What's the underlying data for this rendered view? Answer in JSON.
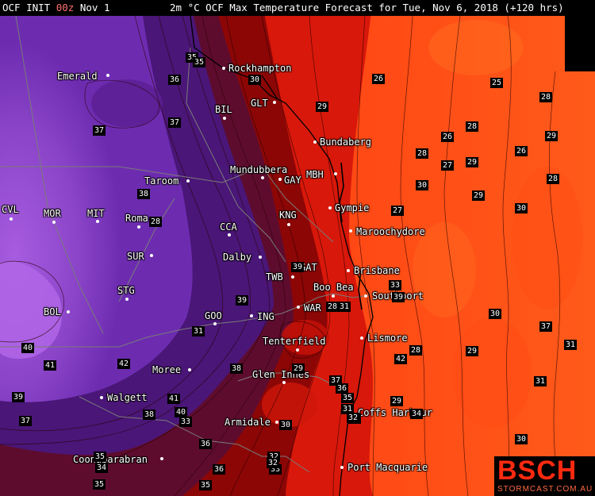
{
  "header": {
    "init_prefix": "OCF INIT ",
    "init_time": "00z",
    "init_date": " Nov 1",
    "title": "2m °C OCF Max Temperature Forecast for Tue, Nov 6, 2018 (+120 hrs)"
  },
  "places": [
    {
      "name": "Rockhampton",
      "dot": "left"
    },
    {
      "name": "Emerald",
      "dot": "right"
    },
    {
      "name": "GLT",
      "dot": "right"
    },
    {
      "name": "BIL",
      "dot": "below"
    },
    {
      "name": "Bundaberg",
      "dot": "left"
    },
    {
      "name": "Mundubbera",
      "dot": "below"
    },
    {
      "name": "GAY",
      "dot": "left"
    },
    {
      "name": "MBH",
      "dot": "right"
    },
    {
      "name": "Taroom",
      "dot": "right"
    },
    {
      "name": "CVL",
      "dot": "below"
    },
    {
      "name": "MOR",
      "dot": "below"
    },
    {
      "name": "MIT",
      "dot": "below"
    },
    {
      "name": "Roma",
      "dot": "below"
    },
    {
      "name": "KNG",
      "dot": "below"
    },
    {
      "name": "Gympie",
      "dot": "left"
    },
    {
      "name": "CCA",
      "dot": "below"
    },
    {
      "name": "Maroochydore",
      "dot": "left"
    },
    {
      "name": "SUR",
      "dot": "right"
    },
    {
      "name": "Dalby",
      "dot": "right"
    },
    {
      "name": "GAT",
      "dot": "left"
    },
    {
      "name": "Brisbane",
      "dot": "left"
    },
    {
      "name": "TWB",
      "dot": "right"
    },
    {
      "name": "Boo Bea",
      "dot": "below"
    },
    {
      "name": "Southport",
      "dot": "left"
    },
    {
      "name": "STG",
      "dot": "below"
    },
    {
      "name": "BOL",
      "dot": "right"
    },
    {
      "name": "WAR",
      "dot": "left"
    },
    {
      "name": "GOO",
      "dot": "below"
    },
    {
      "name": "ING",
      "dot": "left"
    },
    {
      "name": "Lismore",
      "dot": "left"
    },
    {
      "name": "Tenterfield",
      "dot": "below"
    },
    {
      "name": "Moree",
      "dot": "right"
    },
    {
      "name": "Glen Innes",
      "dot": "below"
    },
    {
      "name": "Walgett",
      "dot": "left"
    },
    {
      "name": "Coffs Harbour",
      "dot": "left"
    },
    {
      "name": "Armidale",
      "dot": "right"
    },
    {
      "name": "Coonabarabran",
      "dot": "right"
    },
    {
      "name": "Port Macquarie",
      "dot": "left"
    }
  ],
  "temperature_labels": [
    "35",
    "35",
    "36",
    "30",
    "26",
    "25",
    "28",
    "37",
    "29",
    "37",
    "28",
    "26",
    "28",
    "26",
    "29",
    "29",
    "27",
    "28",
    "30",
    "38",
    "29",
    "30",
    "27",
    "28",
    "39",
    "33",
    "31",
    "28",
    "39",
    "39",
    "30",
    "37",
    "31",
    "40",
    "28",
    "42",
    "29",
    "31",
    "29",
    "41",
    "42",
    "31",
    "37",
    "38",
    "36",
    "39",
    "41",
    "35",
    "29",
    "31",
    "34",
    "38",
    "40",
    "39",
    "33",
    "30",
    "32",
    "37",
    "36",
    "36",
    "30",
    "32",
    "35",
    "34",
    "35",
    "33",
    "35",
    "32"
  ],
  "colors": {
    "ocean_orange": "#ff4a14",
    "coast_red": "#e8200a",
    "inland_dark_red": "#8c0404",
    "deep_purple": "#5a1a9a",
    "light_purple": "#9a52d6"
  },
  "logo": {
    "brand": "BSCH",
    "site": "STORMCAST.COM.AU"
  }
}
